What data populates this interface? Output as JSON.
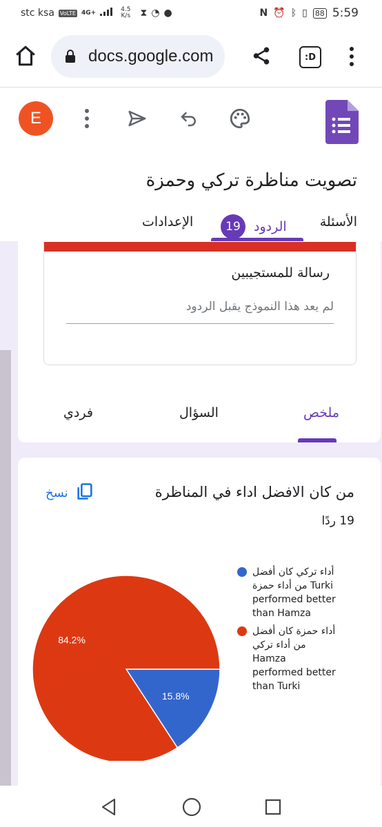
{
  "status_bar": {
    "carrier": "stc ksa",
    "volte": "VoLTE",
    "network": "4G+",
    "speed_value": "4.5",
    "speed_unit": "K/s",
    "battery": "88",
    "time": "5:59"
  },
  "browser": {
    "url": "docs.google.com",
    "tab_count_label": ":D"
  },
  "app_header": {
    "avatar_letter": "E",
    "form_title": "تصويت مناظرة تركي وحمزة",
    "tabs": {
      "questions": "الأسئلة",
      "responses": "الردود",
      "responses_count": "19",
      "settings": "الإعدادات"
    },
    "accent_color": "#673ab7"
  },
  "respondents_card": {
    "title": "رسالة للمستجيبين",
    "message_placeholder": "لم يعد هذا النموذج يقبل الردود",
    "top_bar_color": "#d93025"
  },
  "view_tabs": {
    "summary": "ملخص",
    "question": "السؤال",
    "individual": "فردي"
  },
  "question_card": {
    "title": "من كان الافضل اداء في المناظرة",
    "copy_label": "نسخ",
    "response_count": "19 ردًا"
  },
  "chart_data": {
    "type": "pie",
    "title": "",
    "slices": [
      {
        "label": "أداء تركي كان أفضل من أداء حمزة Turki performed better than Hamza",
        "value": 15.8,
        "color": "#3366cc"
      },
      {
        "label": "أداء حمزة كان أفضل من أداء تركي Hamza performed better than Turki",
        "value": 84.2,
        "color": "#dc3912"
      }
    ],
    "data_labels": [
      "15.8%",
      "84.2%"
    ],
    "legend_position": "right"
  },
  "legend": {
    "item1_line1": "أداء تركي كان أفضل",
    "item1_line2": "من أداء حمزة Turki",
    "item1_line3": "performed better",
    "item1_line4": "than Hamza",
    "item2_line1": "أداء حمزة كان أفضل",
    "item2_line2": "من أداء تركي",
    "item2_line3": "Hamza",
    "item2_line4": "performed better",
    "item2_line5": "than Turki"
  },
  "icons": {
    "home": "home-icon",
    "lock": "lock-icon",
    "share": "share-icon",
    "menu": "overflow-menu-icon",
    "send": "send-icon",
    "undo": "undo-icon",
    "palette": "palette-icon",
    "forms_logo": "google-forms-icon",
    "copy": "copy-icon"
  }
}
